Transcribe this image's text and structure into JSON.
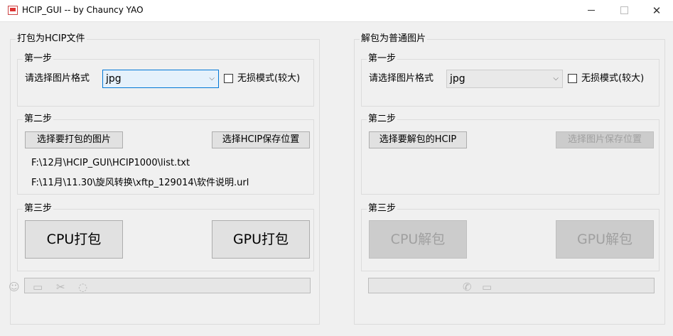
{
  "window": {
    "title": "HCIP_GUI -- by Chauncy YAO"
  },
  "pack": {
    "group_title": "打包为HCIP文件",
    "step1": {
      "title": "第一步",
      "format_label": "请选择图片格式",
      "format_value": "jpg",
      "lossless_label": "无损模式(较大)"
    },
    "step2": {
      "title": "第二步",
      "select_images_button": "选择要打包的图片",
      "save_location_button": "选择HCIP保存位置",
      "path1": "F:\\12月\\HCIP_GUI\\HCIP1000\\list.txt",
      "path2": "F:\\11月\\11.30\\旋风转换\\xftp_129014\\软件说明.url"
    },
    "step3": {
      "title": "第三步",
      "cpu_button": "CPU打包",
      "gpu_button": "GPU打包"
    }
  },
  "unpack": {
    "group_title": "解包为普通图片",
    "step1": {
      "title": "第一步",
      "format_label": "请选择图片格式",
      "format_value": "jpg",
      "lossless_label": "无损模式(较大)"
    },
    "step2": {
      "title": "第二步",
      "select_hcip_button": "选择要解包的HCIP",
      "save_location_button": "选择图片保存位置"
    },
    "step3": {
      "title": "第三步",
      "cpu_button": "CPU解包",
      "gpu_button": "GPU解包"
    }
  }
}
